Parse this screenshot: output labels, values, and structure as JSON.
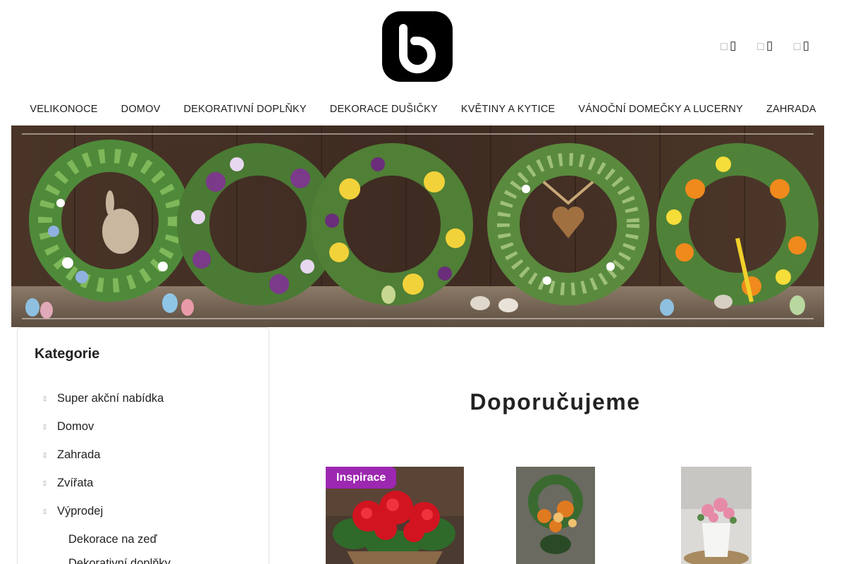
{
  "header": {
    "logo_icon": "brand-b-logo",
    "icons": [
      {
        "name": "search-icon",
        "glyph": "⌕"
      },
      {
        "name": "user-icon",
        "glyph": "👤"
      },
      {
        "name": "cart-icon",
        "glyph": "🛒"
      }
    ]
  },
  "nav": {
    "items": [
      "VELIKONOCE",
      "DOMOV",
      "DEKORATIVNÍ DOPLŇKY",
      "DEKORACE DUŠIČKY",
      "KVĚTINY A KYTICE",
      "VÁNOČNÍ DOMEČKY A LUCERNY",
      "ZAHRADA"
    ]
  },
  "sidebar": {
    "title": "Kategorie",
    "items": [
      "Super akční nabídka",
      "Domov",
      "Zahrada",
      "Zvířata",
      "Výprodej"
    ],
    "sub_items": [
      "Dekorace na zeď",
      "Dekorativní doplňky"
    ]
  },
  "main": {
    "section_title": "Doporučujeme",
    "badge": "Inspirace"
  },
  "colors": {
    "badge_purple": "#9c27b0",
    "text": "#222222"
  }
}
